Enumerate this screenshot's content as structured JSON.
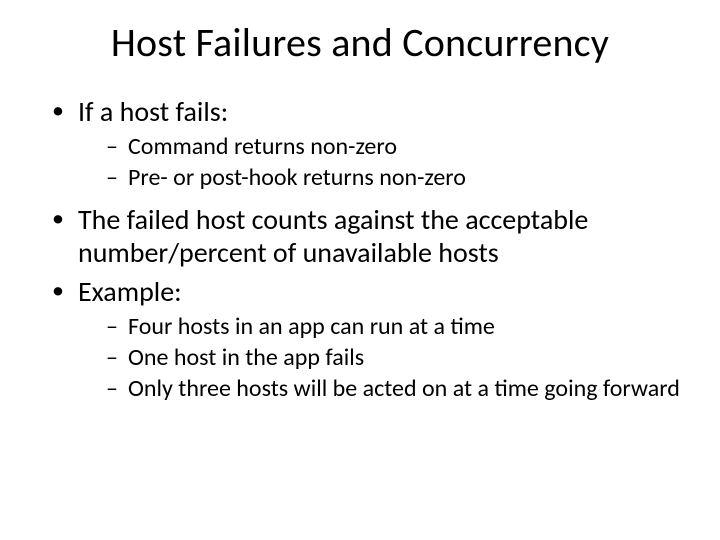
{
  "slide": {
    "title": "Host Failures and Concurrency",
    "bullets": [
      {
        "text": "If a host fails:",
        "sub": [
          "Command returns non-zero",
          "Pre- or post-hook returns non-zero"
        ]
      },
      {
        "text": "The failed host counts against the acceptable number/percent of unavailable hosts",
        "sub": []
      },
      {
        "text": "Example:",
        "sub": [
          "Four hosts in an app can run at a time",
          "One host in the app fails",
          "Only three hosts will be acted on at a time going forward"
        ]
      }
    ]
  }
}
